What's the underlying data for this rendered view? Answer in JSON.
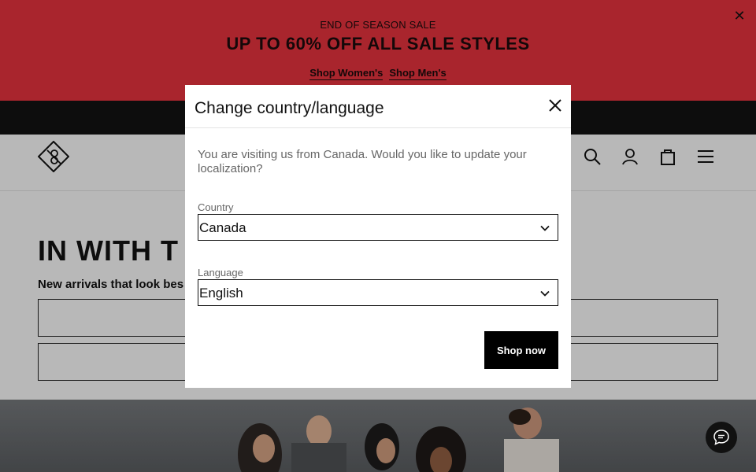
{
  "promo": {
    "eyebrow": "END OF SEASON SALE",
    "headline": "UP TO 60% OFF ALL SALE STYLES",
    "links": [
      "Shop Women's",
      "Shop Men's"
    ],
    "background": "#d9303a"
  },
  "header": {
    "logo": "brand-diamond-logo",
    "icons": [
      "search-icon",
      "account-icon",
      "bag-icon",
      "menu-icon"
    ]
  },
  "hero": {
    "title": "IN WITH T",
    "subtitle": "New arrivals that look bes"
  },
  "modal": {
    "title": "Change country/language",
    "message": "You are visiting us from Canada. Would you like to update your localization?",
    "country_label": "Country",
    "country_value": "Canada",
    "language_label": "Language",
    "language_value": "English",
    "submit_label": "Shop now"
  },
  "chat": {
    "icon": "chat-bubble-icon"
  }
}
